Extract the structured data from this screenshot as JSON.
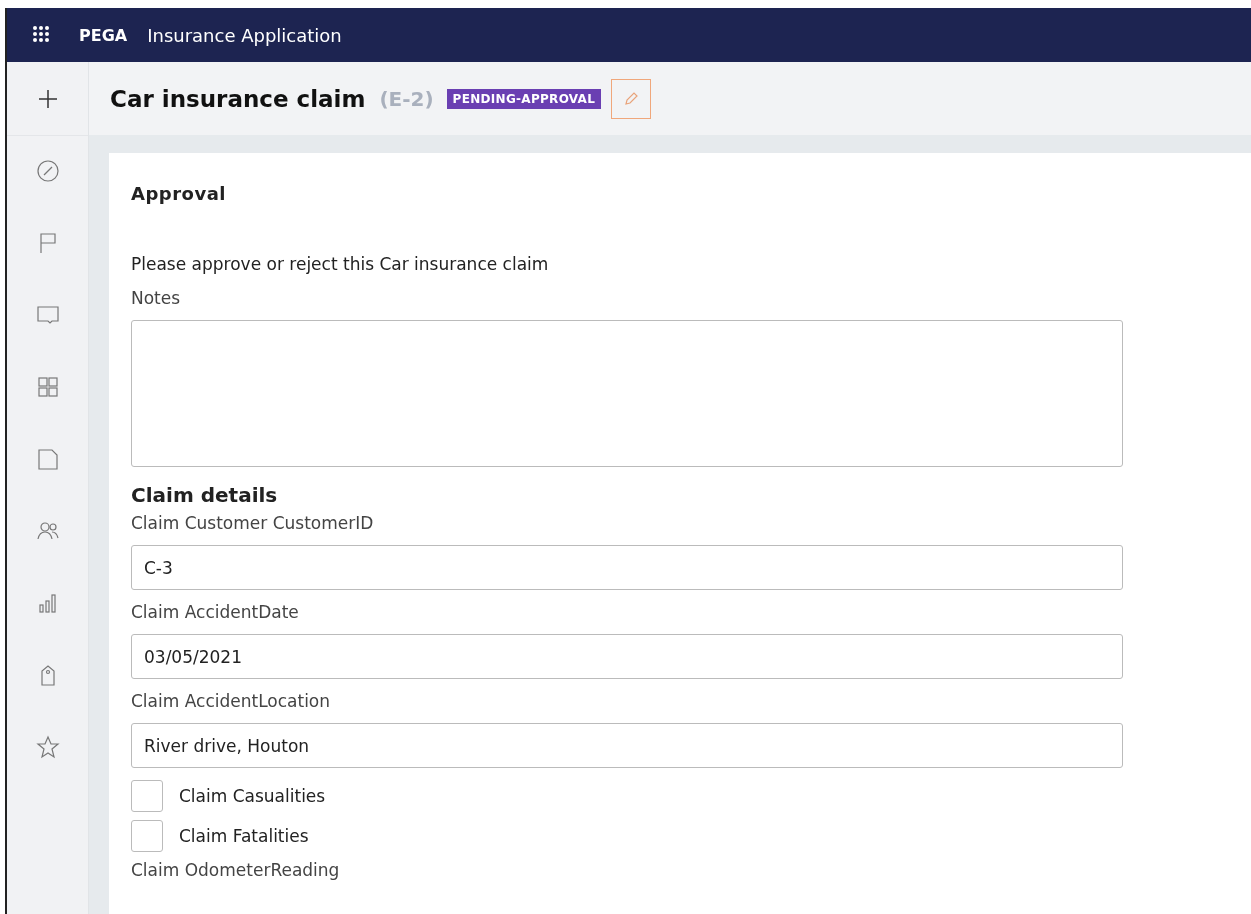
{
  "header": {
    "brand": "PEGA",
    "app_title": "Insurance Application"
  },
  "case": {
    "title": "Car insurance claim",
    "id": "(E-2)",
    "status": "PENDING-APPROVAL"
  },
  "form": {
    "heading": "Approval",
    "instruction": "Please approve or reject this Car insurance claim",
    "notes": {
      "label": "Notes"
    },
    "section": "Claim details",
    "fields": [
      {
        "kind": "text",
        "label": "Claim Customer CustomerID",
        "value": "C-3"
      },
      {
        "kind": "text",
        "label": "Claim AccidentDate",
        "value": "03/05/2021"
      },
      {
        "kind": "text",
        "label": "Claim AccidentLocation",
        "value": "River drive, Houton"
      },
      {
        "kind": "checkbox",
        "label": "Claim Casualities",
        "checked": false
      },
      {
        "kind": "checkbox",
        "label": "Claim Fatalities",
        "checked": false
      },
      {
        "kind": "label",
        "label": "Claim OdometerReading"
      }
    ]
  }
}
